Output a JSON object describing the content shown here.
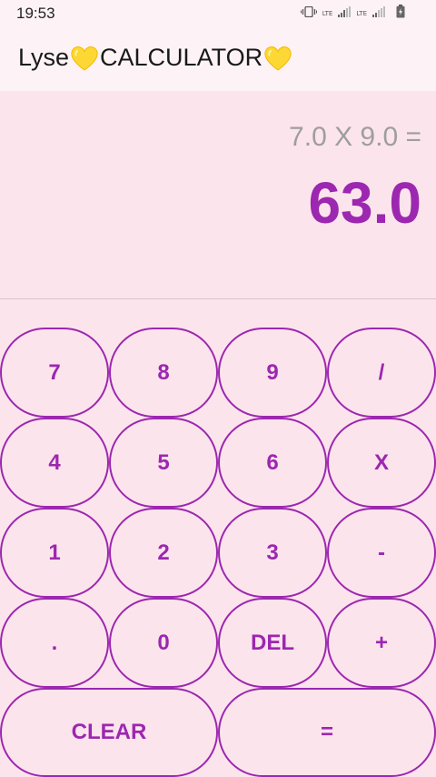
{
  "status_bar": {
    "time": "19:53",
    "network_1": "LTE",
    "network_2": "LTE",
    "icons": [
      "vibrate-icon",
      "signal-icon",
      "signal-icon",
      "battery-icon"
    ]
  },
  "app_bar": {
    "title_part_1": "Lyse",
    "title_part_2": "CALCULATOR",
    "title_icon": "yellow-heart-icon"
  },
  "display": {
    "expression": "7.0 X 9.0 =",
    "result": "63.0"
  },
  "keypad": {
    "rows": [
      [
        "7",
        "8",
        "9",
        "/"
      ],
      [
        "4",
        "5",
        "6",
        "X"
      ],
      [
        "1",
        "2",
        "3",
        "-"
      ],
      [
        ".",
        "0",
        "DEL",
        "+"
      ],
      [
        "CLEAR",
        "="
      ]
    ]
  },
  "colors": {
    "accent": "#9c27b0",
    "background": "#fce4ec",
    "app_bar": "#fdf3f6",
    "expression": "#9e9e9e"
  }
}
